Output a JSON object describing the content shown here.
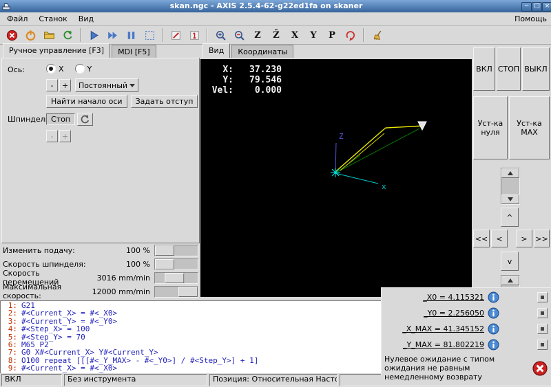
{
  "colors": {
    "titlebar_top": "#7da7d8",
    "titlebar_bottom": "#35639b",
    "canvas_bg": "#000000",
    "toolpath_yellow": "#e8e800",
    "axis_z_blue": "#5555dd",
    "axis_x_cyan": "#00cccc",
    "rapid_green": "#007700",
    "origin_cyan": "#00e8e8",
    "gcode_number_red": "#c03000",
    "gcode_text_blue": "#2222bb",
    "error_red": "#cc2222",
    "info_blue": "#4a8ad4"
  },
  "window": {
    "title": "skan.ngc - AXIS 2.5.4-62-g22ed1fa on skaner",
    "controls": [
      {
        "name": "minimize-button",
        "glyph": "−"
      },
      {
        "name": "maximize-button",
        "glyph": "□"
      },
      {
        "name": "close-button",
        "glyph": "×"
      }
    ]
  },
  "menubar": {
    "items": [
      "Файл",
      "Станок",
      "Вид"
    ],
    "help": "Помощь"
  },
  "toolbar": {
    "buttons": [
      {
        "name": "estop-icon"
      },
      {
        "name": "power-icon"
      },
      {
        "name": "open-file-icon"
      },
      {
        "name": "reload-icon"
      },
      {
        "sep": true
      },
      {
        "name": "run-icon"
      },
      {
        "name": "run-step-icon"
      },
      {
        "name": "pause-icon"
      },
      {
        "name": "block-delete-icon"
      },
      {
        "sep": true
      },
      {
        "name": "skip-lines-icon"
      },
      {
        "name": "optional-stop-icon"
      },
      {
        "sep": true
      },
      {
        "name": "zoom-in-icon"
      },
      {
        "name": "zoom-out-icon"
      },
      {
        "name": "view-z-icon",
        "glyph": "Z"
      },
      {
        "name": "view-z-rot-icon",
        "glyph": "Z̄"
      },
      {
        "name": "view-x-icon",
        "glyph": "X"
      },
      {
        "name": "view-y-icon",
        "glyph": "Y"
      },
      {
        "name": "view-p-icon",
        "glyph": "P"
      },
      {
        "name": "rotate-view-icon"
      },
      {
        "sep": true
      },
      {
        "name": "clear-plot-icon"
      }
    ]
  },
  "manual": {
    "tabs": [
      {
        "id": "manual",
        "label": "Ручное управление [F3]",
        "active": true
      },
      {
        "id": "mdi",
        "label": "MDI [F5]",
        "active": false
      }
    ],
    "axis_label": "Ось:",
    "axes": [
      {
        "label": "X",
        "selected": true
      },
      {
        "label": "Y",
        "selected": false
      }
    ],
    "jog_minus": "-",
    "jog_plus": "+",
    "jog_mode": "Постоянный",
    "home_button": "Найти начало оси",
    "offset_button": "Задать отступ",
    "spindle_label": "Шпиндель:",
    "spindle_stop_button": "Стоп",
    "spindle_minus": "-",
    "spindle_plus": "+"
  },
  "overrides": [
    {
      "label": "Изменить подачу:",
      "value": "100 %",
      "pos": 0
    },
    {
      "label": "Скорость шпинделя:",
      "value": "100 %",
      "pos": 0
    },
    {
      "label": "Скорость перемещений",
      "value": "3016 mm/min",
      "pos": 42
    },
    {
      "label": "Максимальная скорость:",
      "value": "12000 mm/min",
      "pos": 100
    }
  ],
  "preview": {
    "tabs": [
      {
        "id": "view",
        "label": "Вид",
        "active": true
      },
      {
        "id": "coords",
        "label": "Координаты",
        "active": false
      }
    ],
    "dro": [
      {
        "label": "X:",
        "value": "37.230"
      },
      {
        "label": "Y:",
        "value": "79.546"
      },
      {
        "label": "Vel:",
        "value": "0.000"
      }
    ],
    "axis_z_label": "Z",
    "axis_x_label": "x"
  },
  "gcode": {
    "lines": [
      {
        "n": "1:",
        "code": "G21"
      },
      {
        "n": "2:",
        "code": "#<Current_X> = #<_X0>"
      },
      {
        "n": "3:",
        "code": "#<Current_Y> = #<_Y0>"
      },
      {
        "n": "4:",
        "code": "#<Step_X> = 100"
      },
      {
        "n": "5:",
        "code": "#<Step_Y> = 70"
      },
      {
        "n": "6:",
        "code": "M65 P2"
      },
      {
        "n": "7:",
        "code": "G0 X#<Current_X> Y#<Current_Y>"
      },
      {
        "n": "8:",
        "code": "O100 repeat [[[#<_Y_MAX> - #<_Y0>] / #<Step_Y>] + 1]"
      },
      {
        "n": "9:",
        "code": "#<Current_X> = #<_X0>"
      }
    ]
  },
  "vcp": {
    "on_label": "ВКЛ",
    "stop_label": "СТОП",
    "off_label": "ВЫКЛ",
    "set_zero_label": "Уст-ка нуля",
    "set_max_label": "Уст-ка MAX",
    "jog": {
      "up": "^",
      "down": "v",
      "left_fast": "<<",
      "left": "<",
      "right": ">",
      "right_fast": ">>"
    }
  },
  "values_panel": {
    "rows": [
      {
        "label": "_X0 = 4.115321"
      },
      {
        "label": "_Y0 = 2.256050"
      },
      {
        "label": "_X_MAX = 41.345152"
      },
      {
        "label": "_Y_MAX = 81.802219"
      }
    ],
    "message": "Нулевое ожидание с типом ожидания не равным немедленному возврату"
  },
  "statusbar": {
    "sections": [
      "ВКЛ",
      "Без инструмента",
      "Позиция: Относительная Насто"
    ]
  }
}
